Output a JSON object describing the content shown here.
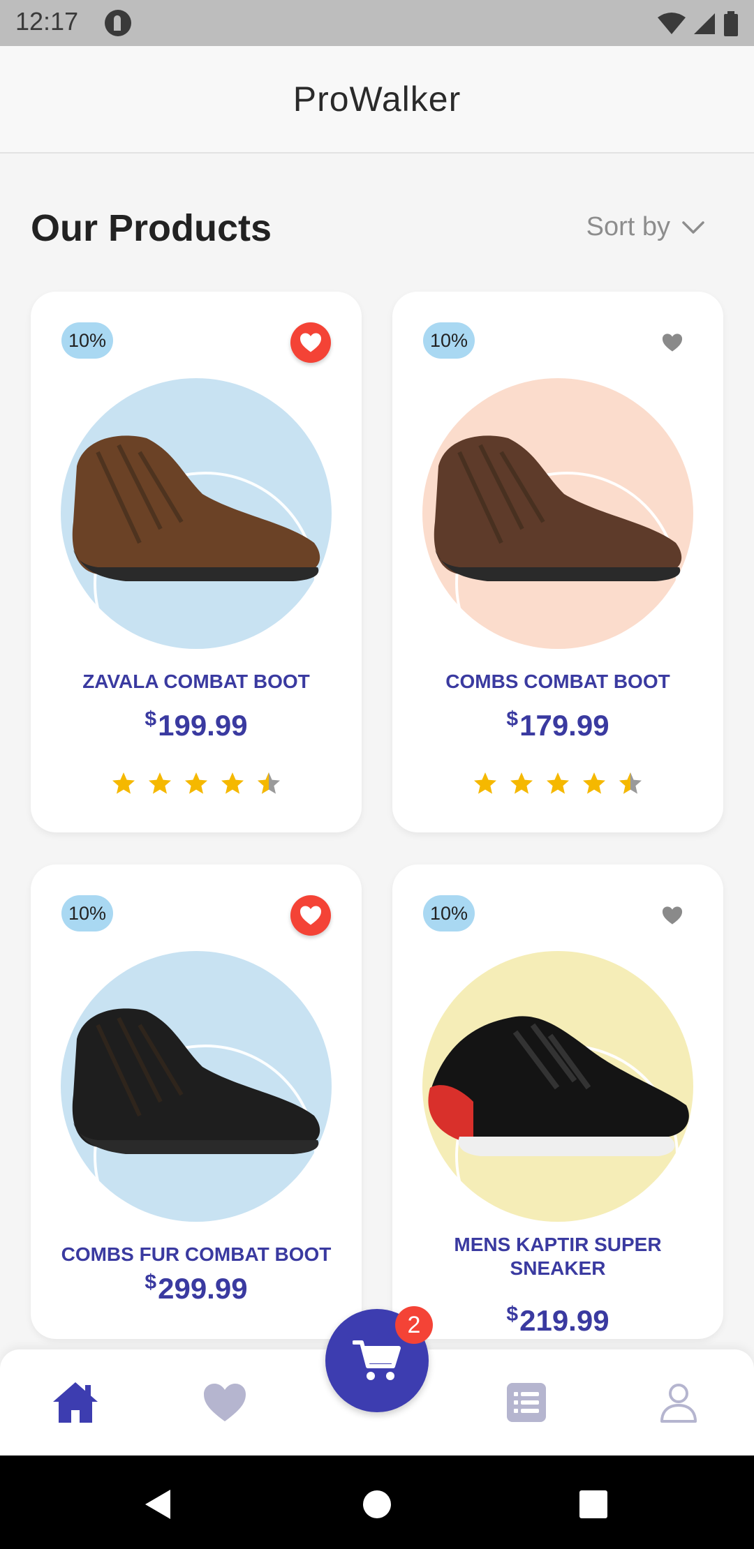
{
  "status_bar": {
    "time": "12:17"
  },
  "app_bar": {
    "title": "ProWalker"
  },
  "section": {
    "title": "Our Products",
    "sort_label": "Sort by"
  },
  "products": [
    {
      "name": "ZAVALA COMBAT BOOT",
      "currency": "$",
      "price": "199.99",
      "discount": "10%",
      "favorited": true,
      "rating": 4.5,
      "circle_color": "#c8e2f2",
      "shoe_color": "#6b4226"
    },
    {
      "name": "COMBS COMBAT BOOT",
      "currency": "$",
      "price": "179.99",
      "discount": "10%",
      "favorited": false,
      "rating": 4.5,
      "circle_color": "#fbdccc",
      "shoe_color": "#5e3b2a"
    },
    {
      "name": "COMBS FUR COMBAT BOOT",
      "currency": "$",
      "price": "299.99",
      "discount": "10%",
      "favorited": true,
      "rating": null,
      "circle_color": "#c8e2f2",
      "shoe_color": "#1e1e1e"
    },
    {
      "name": "MENS KAPTIR SUPER SNEAKER",
      "currency": "$",
      "price": "219.99",
      "discount": "10%",
      "favorited": false,
      "rating": null,
      "circle_color": "#f5edb7",
      "shoe_color": "#141414"
    }
  ],
  "cart": {
    "count": "2"
  },
  "colors": {
    "accent": "#3d3db0",
    "favorite": "#f44336",
    "star": "#f5b800",
    "badge": "#a9d8f2"
  },
  "nav": {
    "items": [
      "home-icon",
      "heart-icon",
      "cart-icon",
      "list-icon",
      "profile-icon"
    ],
    "active": "home-icon"
  }
}
